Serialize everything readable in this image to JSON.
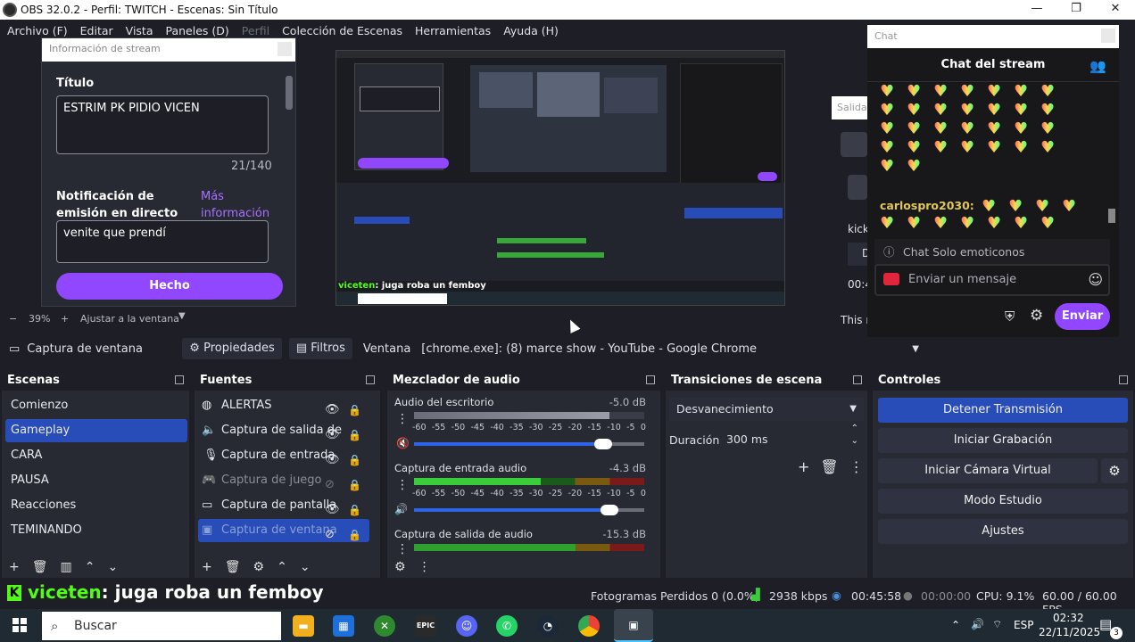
{
  "titlebar": {
    "title": "OBS 32.0.2 - Perfil: TWITCH - Escenas: Sin Título",
    "minimize": "—",
    "maximize": "❐",
    "close": "✕"
  },
  "menu": [
    "Archivo (F)",
    "Editar",
    "Vista",
    "Paneles (D)",
    "Perfil",
    "Colección de Escenas",
    "Herramientas",
    "Ayuda (H)"
  ],
  "stream_info": {
    "header": "Información de stream",
    "title_label": "Título",
    "title_value": "ESTRIM PK PIDIO VICEN",
    "char_count": "21/140",
    "notification_label": "Notificación de emisión en directo",
    "more_info": "Más información",
    "notification_value": "venite que prendí",
    "done_button": "Hecho"
  },
  "preview": {
    "overlay_user": "viceten",
    "overlay_msg": ": juga roba un femboy"
  },
  "chat": {
    "header": "Chat",
    "title": "Chat del stream",
    "user": "carlospro2030:",
    "notice": "Chat Solo emoticonos",
    "placeholder": "Enviar un mensaje",
    "send": "Enviar"
  },
  "behind": {
    "salida": "Salida",
    "kick": "kick",
    "d": "D",
    "time": "00:4",
    "this": "This r"
  },
  "zoom": {
    "minus": "−",
    "percent": "39%",
    "plus": "+",
    "fit": "Ajustar a la ventana"
  },
  "source_bar": {
    "source_name": "Captura de ventana",
    "properties": "Propiedades",
    "filters": "Filtros",
    "window_label": "Ventana",
    "window_value": "[chrome.exe]: (8) marce show - YouTube - Google Chrome"
  },
  "scenes": {
    "title": "Escenas",
    "items": [
      "Comienzo",
      "Gameplay",
      "CARA",
      "PAUSA",
      "Reacciones",
      "TEMINANDO"
    ],
    "selected": "Gameplay"
  },
  "sources": {
    "title": "Fuentes",
    "items": [
      "ALERTAS",
      "Captura de salida de",
      "Captura de entrada",
      "Captura de juego",
      "Captura de pantalla",
      "Captura de ventana"
    ]
  },
  "mixer": {
    "title": "Mezclador de audio",
    "channels": [
      {
        "name": "Audio del escritorio",
        "db": "-5.0 dB",
        "level": 0.85,
        "fader": 0.82
      },
      {
        "name": "Captura de entrada audio",
        "db": "-4.3 dB",
        "level": 0.55,
        "fader": 0.85
      },
      {
        "name": "Captura de salida de audio",
        "db": "-15.3 dB",
        "level": 0.7
      }
    ],
    "scale": [
      "-60",
      "-55",
      "-50",
      "-45",
      "-40",
      "-35",
      "-30",
      "-25",
      "-20",
      "-15",
      "-10",
      "-5",
      "0"
    ]
  },
  "transitions": {
    "title": "Transiciones de escena",
    "selected": "Desvanecimiento",
    "duration_label": "Duración",
    "duration_value": "300 ms"
  },
  "controls": {
    "title": "Controles",
    "stop_stream": "Detener Transmisión",
    "start_record": "Iniciar Grabación",
    "virtual_cam": "Iniciar Cámara Virtual",
    "studio_mode": "Modo Estudio",
    "settings": "Ajustes"
  },
  "status": {
    "overlay_user": "viceten",
    "overlay_msg": ": juga roba un femboy",
    "dropped": "Fotogramas Perdidos 0 (0.0%)",
    "bitrate": "2938 kbps",
    "stream_time": "00:45:58",
    "rec_time": "00:00:00",
    "cpu": "CPU: 9.1%",
    "fps": "60.00 / 60.00 FPS"
  },
  "taskbar": {
    "search": "Buscar",
    "lang": "ESP",
    "time": "02:32",
    "date": "22/11/2025",
    "notif_count": "3"
  },
  "colors": {
    "accent": "#284cb8",
    "twitch": "#9147ff",
    "kick": "#53fc18"
  }
}
